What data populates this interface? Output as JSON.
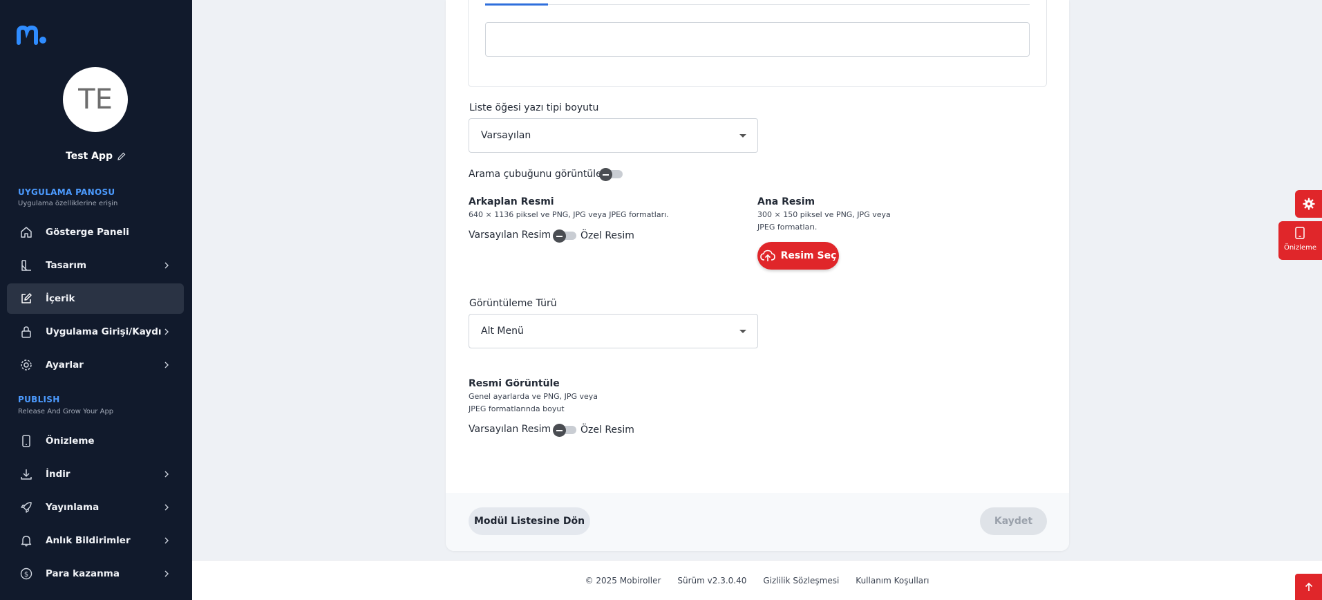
{
  "sidebar": {
    "avatar_initials": "TE",
    "app_name": "Test App",
    "section1": {
      "title": "UYGULAMA PANOSU",
      "subtitle": "Uygulama özelliklerine erişin"
    },
    "section2": {
      "title": "PUBLISH",
      "subtitle": "Release And Grow Your App"
    },
    "items": [
      {
        "label": "Gösterge Paneli",
        "icon": "home-icon"
      },
      {
        "label": "Tasarım",
        "icon": "design-icon"
      },
      {
        "label": "İçerik",
        "icon": "edit-icon"
      },
      {
        "label": "Uygulama Girişi/Kaydı",
        "icon": "lock-icon"
      },
      {
        "label": "Ayarlar",
        "icon": "gear-icon"
      },
      {
        "label": "Önizleme",
        "icon": "phone-icon"
      },
      {
        "label": "İndir",
        "icon": "download-icon"
      },
      {
        "label": "Yayınlama",
        "icon": "rocket-icon"
      },
      {
        "label": "Anlık Bildirimler",
        "icon": "bell-icon"
      },
      {
        "label": "Para kazanma",
        "icon": "dollar-icon"
      }
    ]
  },
  "form": {
    "font_size_label": "Liste öğesi yazı tipi boyutu",
    "font_size_value": "Varsayılan",
    "search_bar_label": "Arama çubuğunu görüntüle",
    "background": {
      "title": "Arkaplan Resmi",
      "hint": "640 × 1136 piksel ve PNG, JPG veya JPEG formatları.",
      "toggle_left": "Varsayılan Resim",
      "toggle_right": "Özel Resim"
    },
    "main_image": {
      "title": "Ana Resim",
      "hint_line1": "300 × 150 piksel ve PNG, JPG veya",
      "hint_line2": "JPEG formatları.",
      "button": "Resim Seç"
    },
    "display_type_label": "Görüntüleme Türü",
    "display_type_value": "Alt Menü",
    "show_image": {
      "title": "Resmi Görüntüle",
      "hint_line1": "Genel ayarlarda ve PNG, JPG veya",
      "hint_line2": "JPEG formatlarında boyut",
      "toggle_left": "Varsayılan Resim",
      "toggle_right": "Özel Resim"
    }
  },
  "actions": {
    "back": "Modül Listesine Dön",
    "save": "Kaydet"
  },
  "footer": {
    "copyright": "© 2025 Mobiroller",
    "version": "Sürüm v2.3.0.40",
    "privacy": "Gizlilik Sözleşmesi",
    "terms": "Kullanım Koşulları"
  },
  "floating": {
    "preview_label": "Önizleme"
  },
  "colors": {
    "sidebar_bg": "#111a2c",
    "accent_red": "#e0262a",
    "accent_blue": "#4c9bff"
  }
}
